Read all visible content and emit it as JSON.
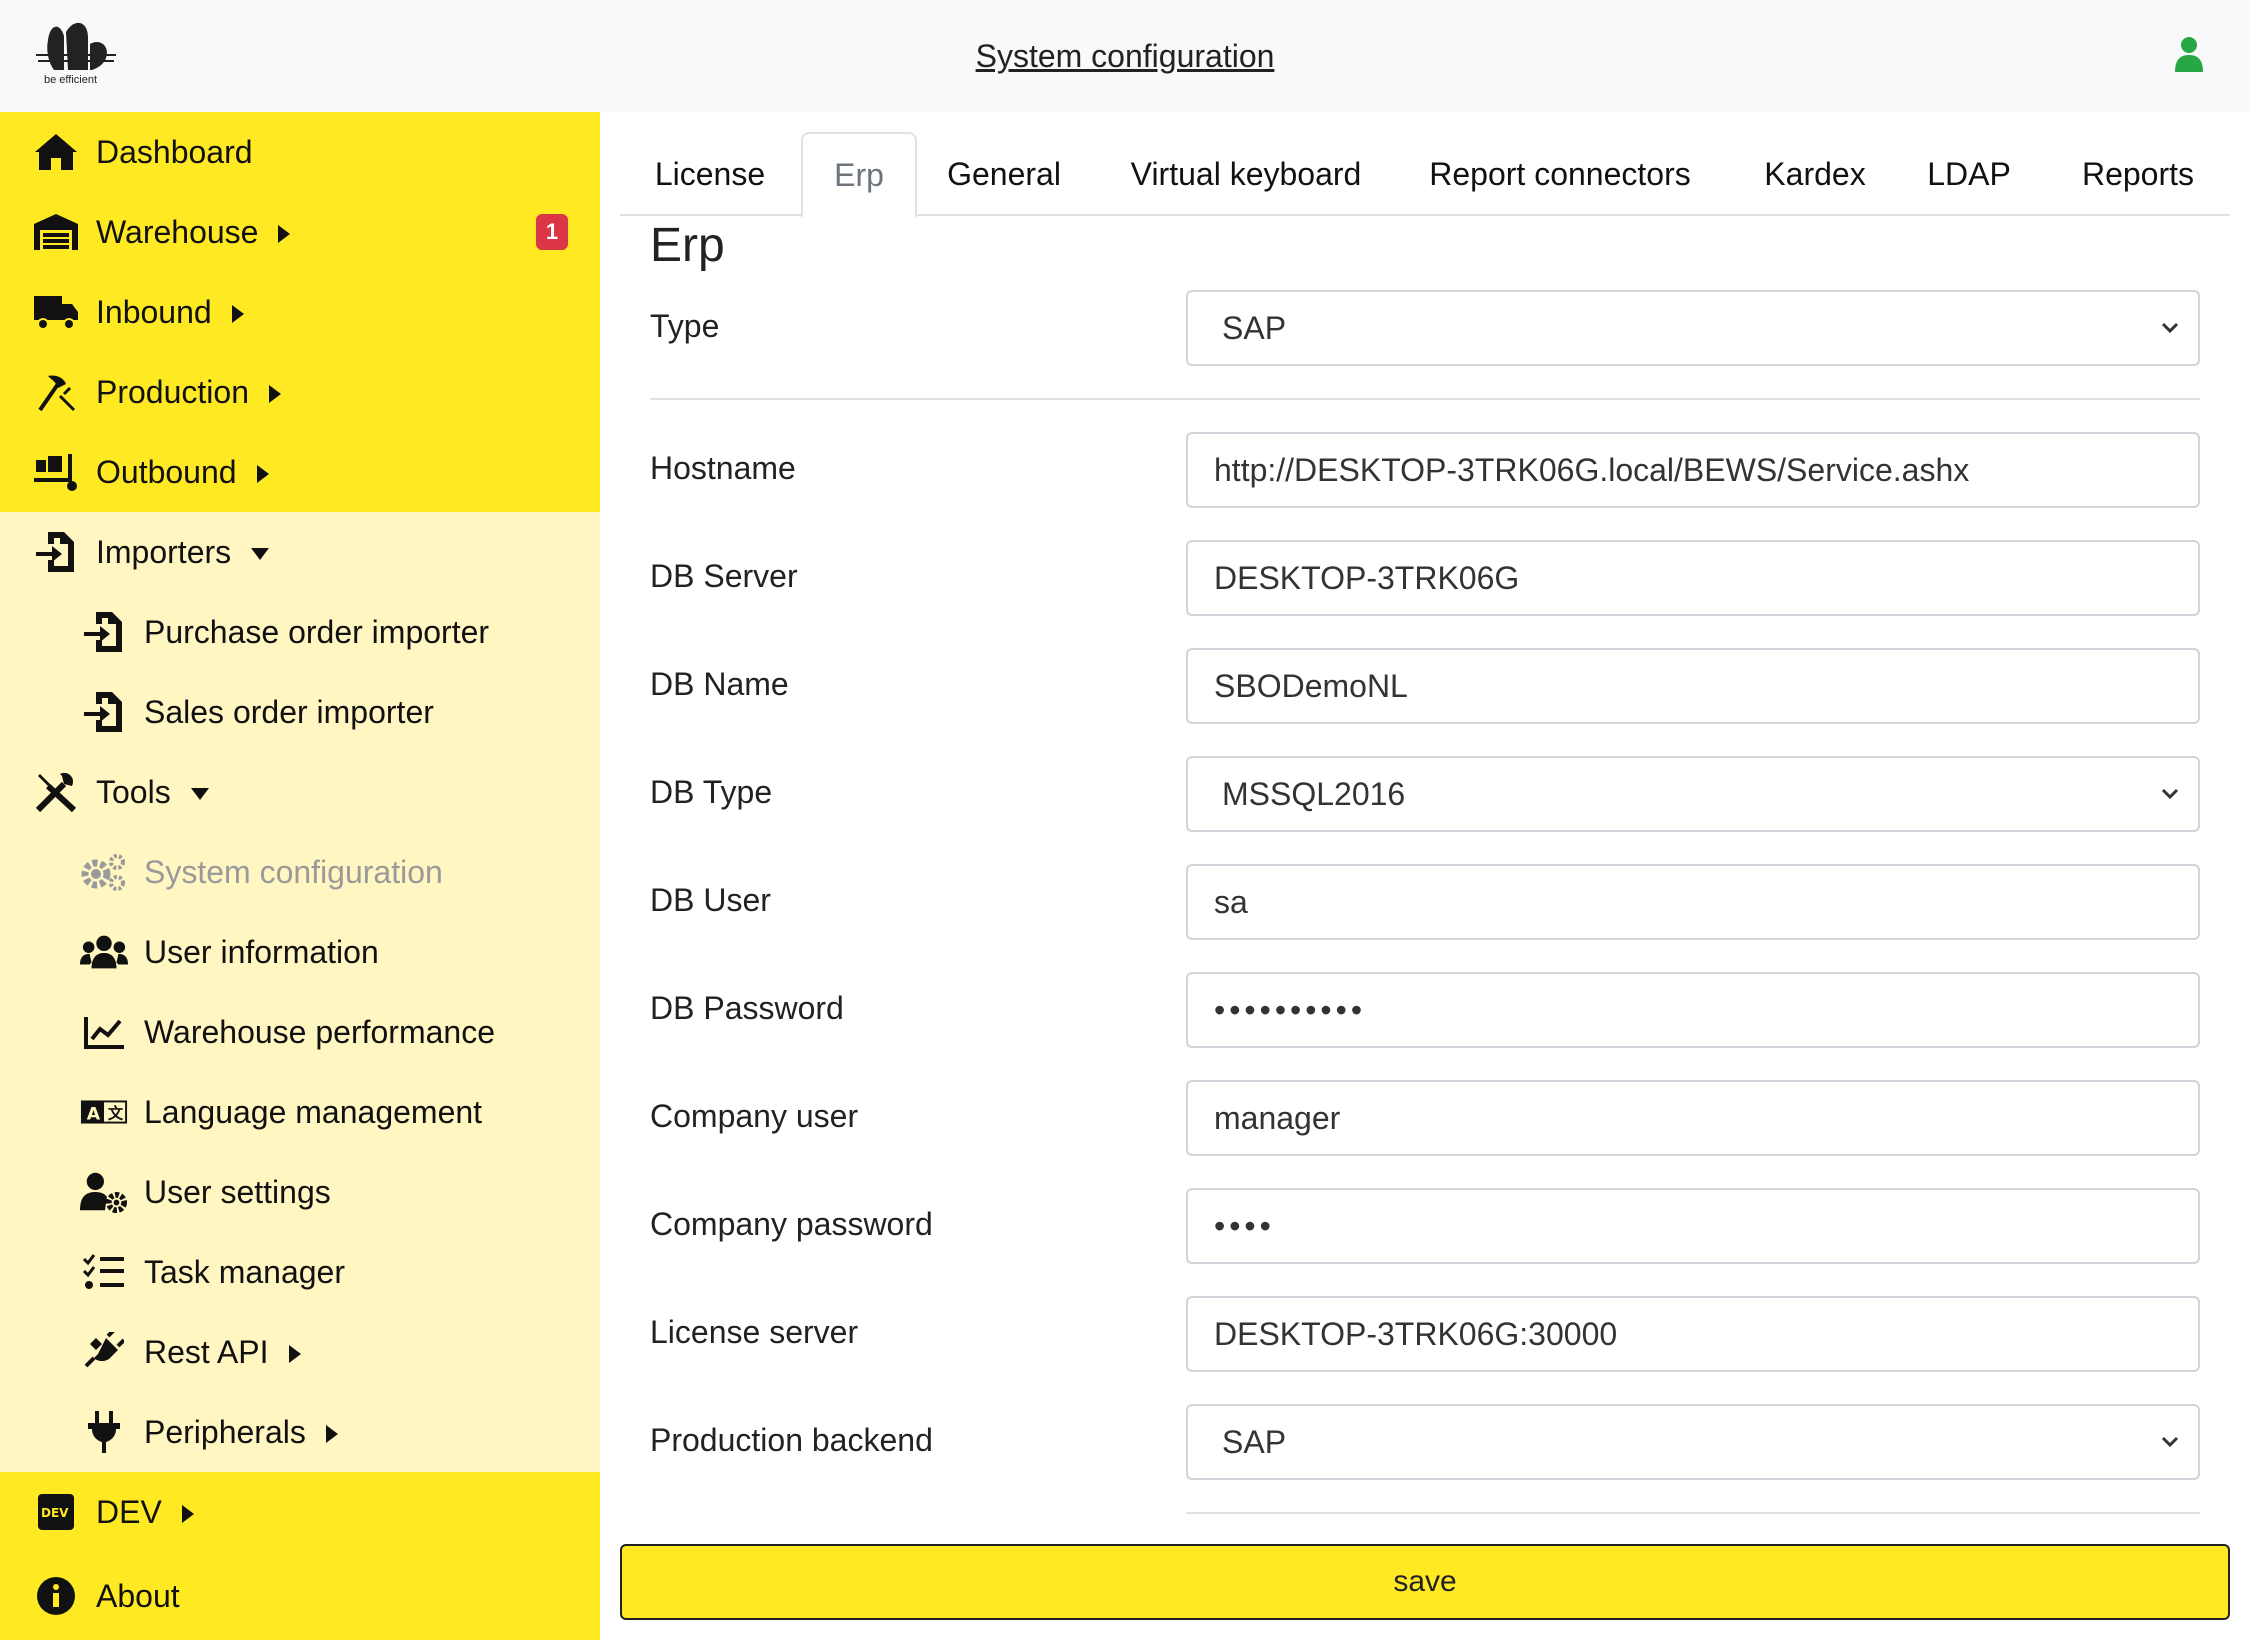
{
  "header": {
    "title": "System configuration",
    "logo_text": "be efficient",
    "user_icon": "user-icon"
  },
  "sidebar": {
    "items": [
      {
        "label": "Dashboard",
        "icon": "home-icon"
      },
      {
        "label": "Warehouse",
        "icon": "warehouse-icon",
        "badge": "1"
      },
      {
        "label": "Inbound",
        "icon": "truck-icon"
      },
      {
        "label": "Production",
        "icon": "hammer-pick-icon"
      },
      {
        "label": "Outbound",
        "icon": "dolly-icon"
      },
      {
        "label": "Importers",
        "icon": "file-import-icon"
      },
      {
        "label": "Purchase order importer",
        "icon": "file-import-icon"
      },
      {
        "label": "Sales order importer",
        "icon": "file-import-icon"
      },
      {
        "label": "Tools",
        "icon": "tools-icon"
      },
      {
        "label": "System configuration",
        "icon": "gears-icon"
      },
      {
        "label": "User information",
        "icon": "users-icon"
      },
      {
        "label": "Warehouse performance",
        "icon": "chart-line-icon"
      },
      {
        "label": "Language management",
        "icon": "language-icon"
      },
      {
        "label": "User settings",
        "icon": "user-gear-icon"
      },
      {
        "label": "Task manager",
        "icon": "list-check-icon"
      },
      {
        "label": "Rest API",
        "icon": "plug-connect-icon"
      },
      {
        "label": "Peripherals",
        "icon": "plug-icon"
      },
      {
        "label": "DEV",
        "icon": "dev-icon"
      },
      {
        "label": "About",
        "icon": "info-icon"
      }
    ]
  },
  "tabs": [
    "License",
    "Erp",
    "General",
    "Virtual keyboard",
    "Report connectors",
    "Kardex",
    "LDAP",
    "Reports"
  ],
  "active_tab": "Erp",
  "form": {
    "section_title": "Erp",
    "type": {
      "label": "Type",
      "value": "SAP"
    },
    "hostname": {
      "label": "Hostname",
      "value": "http://DESKTOP-3TRK06G.local/BEWS/Service.ashx"
    },
    "db_server": {
      "label": "DB Server",
      "value": "DESKTOP-3TRK06G"
    },
    "db_name": {
      "label": "DB Name",
      "value": "SBODemoNL"
    },
    "db_type": {
      "label": "DB Type",
      "value": "MSSQL2016"
    },
    "db_user": {
      "label": "DB User",
      "value": "sa"
    },
    "db_password": {
      "label": "DB Password",
      "value": "••••••••••"
    },
    "company_user": {
      "label": "Company user",
      "value": "manager"
    },
    "company_password": {
      "label": "Company password",
      "value": "••••"
    },
    "license_server": {
      "label": "License server",
      "value": "DESKTOP-3TRK06G:30000"
    },
    "production_backend": {
      "label": "Production backend",
      "value": "SAP"
    }
  },
  "save_label": "save",
  "colors": {
    "brand_yellow": "#ffe923",
    "submenu_bg": "#fff6c2",
    "badge_red": "#dc3545",
    "user_green": "#28a745"
  }
}
